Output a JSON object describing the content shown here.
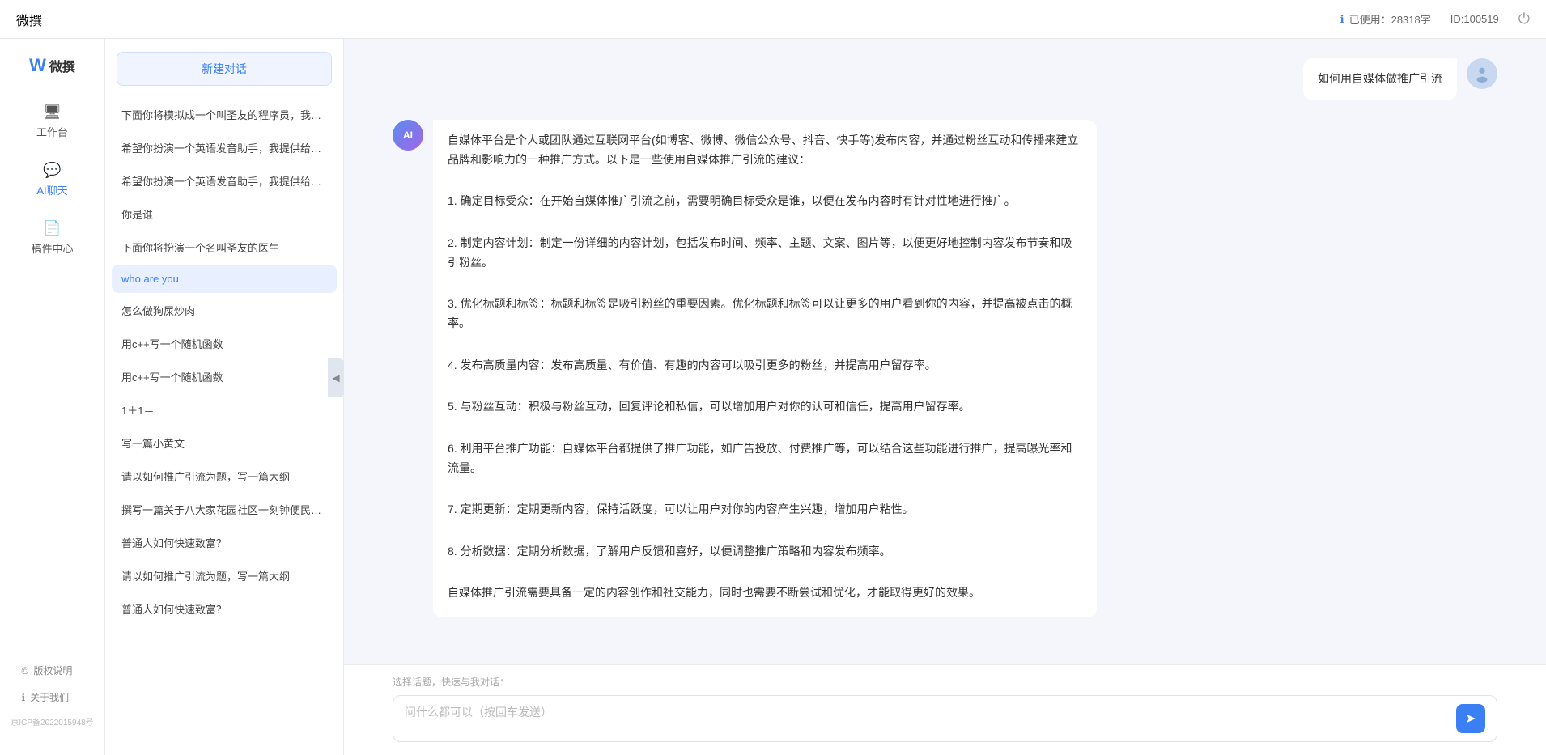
{
  "topbar": {
    "title": "微撰",
    "usage_label": "已使用：28318字",
    "id_label": "ID:100519",
    "usage_icon": "ℹ"
  },
  "left_nav": {
    "items": [
      {
        "id": "workspace",
        "label": "工作台",
        "icon": "🖥"
      },
      {
        "id": "ai-chat",
        "label": "AI聊天",
        "icon": "💬",
        "active": true
      },
      {
        "id": "drafts",
        "label": "稿件中心",
        "icon": "📄"
      }
    ],
    "bottom_items": [
      {
        "id": "copyright",
        "label": "版权说明",
        "icon": "©"
      },
      {
        "id": "about",
        "label": "关于我们",
        "icon": "ℹ"
      }
    ],
    "beian": "京ICP备2022015948号"
  },
  "chat_sidebar": {
    "new_chat_label": "新建对话",
    "chat_items": [
      {
        "id": "c1",
        "text": "下面你将模拟成一个叫圣友的程序员，我说...",
        "active": false
      },
      {
        "id": "c2",
        "text": "希望你扮演一个英语发音助手，我提供给你...",
        "active": false
      },
      {
        "id": "c3",
        "text": "希望你扮演一个英语发音助手，我提供给你...",
        "active": false
      },
      {
        "id": "c4",
        "text": "你是谁",
        "active": false
      },
      {
        "id": "c5",
        "text": "下面你将扮演一个名叫圣友的医生",
        "active": false
      },
      {
        "id": "c6",
        "text": "who are you",
        "active": true
      },
      {
        "id": "c7",
        "text": "怎么做狗屎炒肉",
        "active": false
      },
      {
        "id": "c8",
        "text": "用c++写一个随机函数",
        "active": false
      },
      {
        "id": "c9",
        "text": "用c++写一个随机函数",
        "active": false
      },
      {
        "id": "c10",
        "text": "1＋1＝",
        "active": false
      },
      {
        "id": "c11",
        "text": "写一篇小黄文",
        "active": false
      },
      {
        "id": "c12",
        "text": "请以如何推广引流为题，写一篇大纲",
        "active": false
      },
      {
        "id": "c13",
        "text": "撰写一篇关于八大家花园社区一刻钟便民生...",
        "active": false
      },
      {
        "id": "c14",
        "text": "普通人如何快速致富？",
        "active": false
      },
      {
        "id": "c15",
        "text": "请以如何推广引流为题，写一篇大纲",
        "active": false
      },
      {
        "id": "c16",
        "text": "普通人如何快速致富？",
        "active": false
      }
    ]
  },
  "messages": [
    {
      "id": "m1",
      "role": "user",
      "text": "如何用自媒体做推广引流",
      "avatar_type": "user"
    },
    {
      "id": "m2",
      "role": "ai",
      "text": "自媒体平台是个人或团队通过互联网平台(如博客、微博、微信公众号、抖音、快手等)发布内容，并通过粉丝互动和传播来建立品牌和影响力的一种推广方式。以下是一些使用自媒体推广引流的建议：\n\n1. 确定目标受众：在开始自媒体推广引流之前，需要明确目标受众是谁，以便在发布内容时有针对性地进行推广。\n\n2. 制定内容计划：制定一份详细的内容计划，包括发布时间、频率、主题、文案、图片等，以便更好地控制内容发布节奏和吸引粉丝。\n\n3. 优化标题和标签：标题和标签是吸引粉丝的重要因素。优化标题和标签可以让更多的用户看到你的内容，并提高被点击的概率。\n\n4. 发布高质量内容：发布高质量、有价值、有趣的内容可以吸引更多的粉丝，并提高用户留存率。\n\n5. 与粉丝互动：积极与粉丝互动，回复评论和私信，可以增加用户对你的认可和信任，提高用户留存率。\n\n6. 利用平台推广功能：自媒体平台都提供了推广功能，如广告投放、付费推广等，可以结合这些功能进行推广，提高曝光率和流量。\n\n7. 定期更新：定期更新内容，保持活跃度，可以让用户对你的内容产生兴趣，增加用户粘性。\n\n8. 分析数据：定期分析数据，了解用户反馈和喜好，以便调整推广策略和内容发布频率。\n\n自媒体推广引流需要具备一定的内容创作和社交能力，同时也需要不断尝试和优化，才能取得更好的效果。"
    }
  ],
  "input_area": {
    "quick_topics_label": "选择话题，快速与我对话：",
    "placeholder": "问什么都可以（按回车发送）",
    "send_icon": "➤"
  },
  "collapse_icon": "◀"
}
